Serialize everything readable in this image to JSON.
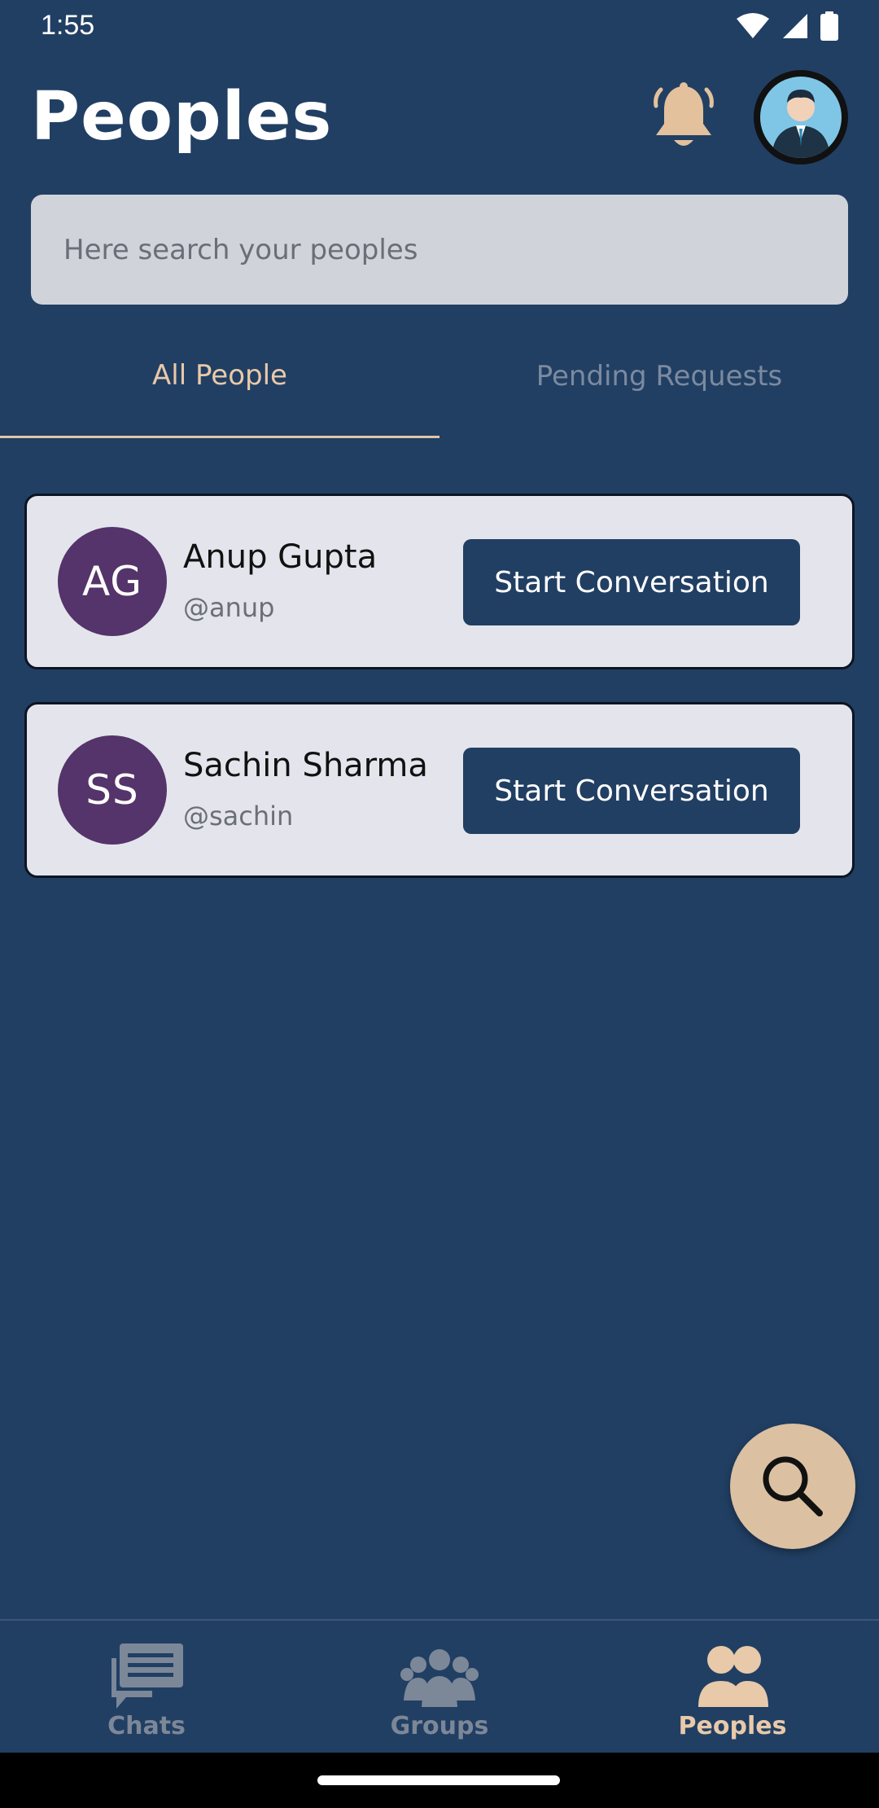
{
  "status_bar": {
    "time": "1:55"
  },
  "header": {
    "title": "Peoples"
  },
  "search": {
    "placeholder": "Here search your peoples"
  },
  "tabs": [
    {
      "label": "All People",
      "selected": true
    },
    {
      "label": "Pending Requests",
      "selected": false
    }
  ],
  "people": [
    {
      "initials": "AG",
      "name": "Anup Gupta",
      "handle": "@anup",
      "button_label": "Start Conversation"
    },
    {
      "initials": "SS",
      "name": "Sachin Sharma",
      "handle": "@sachin",
      "button_label": "Start Conversation"
    }
  ],
  "bottom_nav": [
    {
      "label": "Chats",
      "icon": "chat-icon",
      "active": false
    },
    {
      "label": "Groups",
      "icon": "groups-icon",
      "active": false
    },
    {
      "label": "Peoples",
      "icon": "people-icon",
      "active": true
    }
  ],
  "colors": {
    "background": "#213f63",
    "accent": "#e8c9a9",
    "card": "#e4e5ec",
    "avatar": "#54346a",
    "button": "#213f63",
    "fab": "#dcc0a2"
  }
}
